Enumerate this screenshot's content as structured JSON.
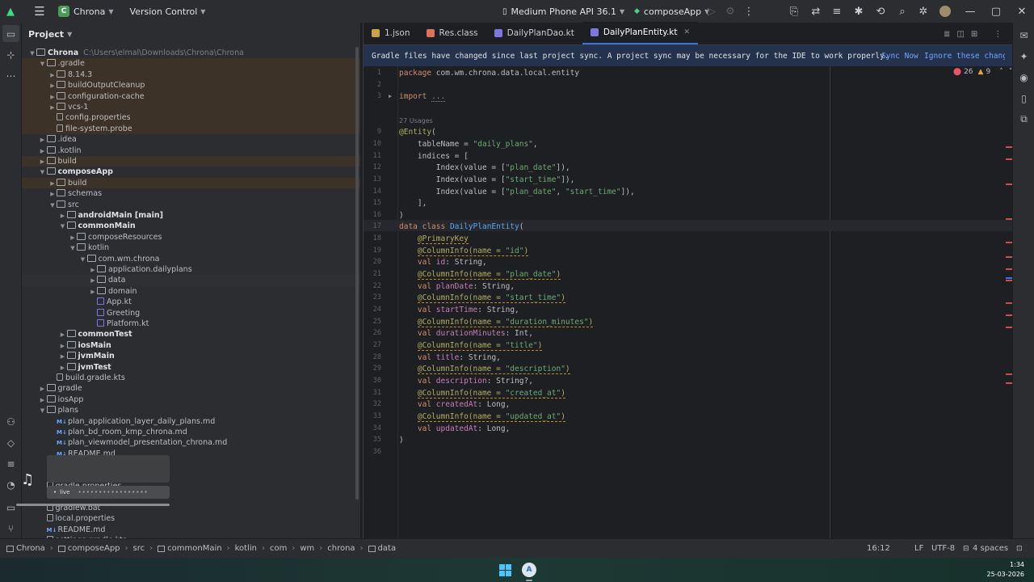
{
  "titlebar": {
    "project": "Chrona",
    "project_initial": "C",
    "version_control": "Version Control",
    "device": "Medium Phone API 36.1",
    "run_config": "composeApp"
  },
  "project_panel": {
    "title": "Project"
  },
  "tree": [
    {
      "label": "Chrona",
      "extra": "C:\\Users\\elmal\\Downloads\\Chrona\\Chrona",
      "indent": 0,
      "arrow": "down",
      "icon": "folder",
      "bold": true,
      "bg": ""
    },
    {
      "label": ".gradle",
      "indent": 1,
      "arrow": "down",
      "icon": "folder",
      "bg": "orange"
    },
    {
      "label": "8.14.3",
      "indent": 2,
      "arrow": "right",
      "icon": "folder",
      "bg": "orange"
    },
    {
      "label": "buildOutputCleanup",
      "indent": 2,
      "arrow": "right",
      "icon": "folder",
      "bg": "orange"
    },
    {
      "label": "configuration-cache",
      "indent": 2,
      "arrow": "right",
      "icon": "folder",
      "bg": "orange"
    },
    {
      "label": "vcs-1",
      "indent": 2,
      "arrow": "right",
      "icon": "folder",
      "bg": "orange"
    },
    {
      "label": "config.properties",
      "indent": 2,
      "arrow": "",
      "icon": "file",
      "bg": "orange"
    },
    {
      "label": "file-system.probe",
      "indent": 2,
      "arrow": "",
      "icon": "file",
      "bg": "orange"
    },
    {
      "label": ".idea",
      "indent": 1,
      "arrow": "right",
      "icon": "folder",
      "bg": ""
    },
    {
      "label": ".kotlin",
      "indent": 1,
      "arrow": "right",
      "icon": "folder",
      "bg": ""
    },
    {
      "label": "build",
      "indent": 1,
      "arrow": "right",
      "icon": "folder",
      "bg": "orange"
    },
    {
      "label": "composeApp",
      "indent": 1,
      "arrow": "down",
      "icon": "folder",
      "bold": true,
      "bg": ""
    },
    {
      "label": "build",
      "indent": 2,
      "arrow": "right",
      "icon": "folder",
      "bg": "orange"
    },
    {
      "label": "schemas",
      "indent": 2,
      "arrow": "right",
      "icon": "folder",
      "bg": ""
    },
    {
      "label": "src",
      "indent": 2,
      "arrow": "down",
      "icon": "folder",
      "bg": ""
    },
    {
      "label": "androidMain [main]",
      "indent": 3,
      "arrow": "right",
      "icon": "folder",
      "bold": true,
      "bg": ""
    },
    {
      "label": "commonMain",
      "indent": 3,
      "arrow": "down",
      "icon": "folder",
      "bold": true,
      "bg": ""
    },
    {
      "label": "composeResources",
      "indent": 4,
      "arrow": "right",
      "icon": "folder",
      "bg": ""
    },
    {
      "label": "kotlin",
      "indent": 4,
      "arrow": "down",
      "icon": "folder",
      "bg": ""
    },
    {
      "label": "com.wm.chrona",
      "indent": 5,
      "arrow": "down",
      "icon": "folder",
      "bg": ""
    },
    {
      "label": "application.dailyplans",
      "indent": 6,
      "arrow": "right",
      "icon": "folder",
      "bg": ""
    },
    {
      "label": "data",
      "indent": 6,
      "arrow": "right",
      "icon": "folder",
      "bg": "hl"
    },
    {
      "label": "domain",
      "indent": 6,
      "arrow": "right",
      "icon": "folder",
      "bg": ""
    },
    {
      "label": "App.kt",
      "indent": 6,
      "arrow": "",
      "icon": "kt",
      "bg": ""
    },
    {
      "label": "Greeting",
      "indent": 6,
      "arrow": "",
      "icon": "kt",
      "bg": ""
    },
    {
      "label": "Platform.kt",
      "indent": 6,
      "arrow": "",
      "icon": "kt",
      "bg": ""
    },
    {
      "label": "commonTest",
      "indent": 3,
      "arrow": "right",
      "icon": "folder",
      "bold": true,
      "bg": ""
    },
    {
      "label": "iosMain",
      "indent": 3,
      "arrow": "right",
      "icon": "folder",
      "bold": true,
      "bg": ""
    },
    {
      "label": "jvmMain",
      "indent": 3,
      "arrow": "right",
      "icon": "folder",
      "bold": true,
      "bg": ""
    },
    {
      "label": "jvmTest",
      "indent": 3,
      "arrow": "right",
      "icon": "folder",
      "bold": true,
      "bg": ""
    },
    {
      "label": "build.gradle.kts",
      "indent": 2,
      "arrow": "",
      "icon": "file",
      "bg": ""
    },
    {
      "label": "gradle",
      "indent": 1,
      "arrow": "right",
      "icon": "folder",
      "bg": ""
    },
    {
      "label": "iosApp",
      "indent": 1,
      "arrow": "right",
      "icon": "folder",
      "bg": ""
    },
    {
      "label": "plans",
      "indent": 1,
      "arrow": "down",
      "icon": "folder",
      "bg": ""
    },
    {
      "label": "plan_application_layer_daily_plans.md",
      "indent": 2,
      "arrow": "",
      "icon": "md",
      "bg": ""
    },
    {
      "label": "plan_bd_room_kmp_chrona.md",
      "indent": 2,
      "arrow": "",
      "icon": "md",
      "bg": ""
    },
    {
      "label": "plan_viewmodel_presentation_chrona.md",
      "indent": 2,
      "arrow": "",
      "icon": "md",
      "bg": ""
    },
    {
      "label": "README.md",
      "indent": 2,
      "arrow": "",
      "icon": "md",
      "bg": ""
    },
    {
      "label": "",
      "indent": 1,
      "arrow": "",
      "icon": "",
      "bg": ""
    },
    {
      "label": "",
      "indent": 1,
      "arrow": "",
      "icon": "",
      "bg": ""
    },
    {
      "label": "gradle.properties",
      "indent": 1,
      "arrow": "",
      "icon": "file",
      "bg": ""
    },
    {
      "label": "",
      "indent": 1,
      "arrow": "",
      "icon": "",
      "bg": ""
    },
    {
      "label": "gradlew.bat",
      "indent": 1,
      "arrow": "",
      "icon": "file",
      "bg": ""
    },
    {
      "label": "local.properties",
      "indent": 1,
      "arrow": "",
      "icon": "file",
      "bg": ""
    },
    {
      "label": "README.md",
      "indent": 1,
      "arrow": "",
      "icon": "md",
      "bg": ""
    },
    {
      "label": "settings.gradle.kts",
      "indent": 1,
      "arrow": "",
      "icon": "file",
      "bg": ""
    }
  ],
  "tabs": [
    {
      "label": "1.json",
      "color": "#c9a24a",
      "active": false
    },
    {
      "label": "Res.class",
      "color": "#d9735b",
      "active": false
    },
    {
      "label": "DailyPlanDao.kt",
      "color": "#7f77dd",
      "active": false
    },
    {
      "label": "DailyPlanEntity.kt",
      "color": "#7f77dd",
      "active": true
    }
  ],
  "banner": {
    "message": "Gradle files have changed since last project sync. A project sync may be necessary for the IDE to work properly.",
    "sync_now": "Sync Now",
    "ignore": "Ignore these changes"
  },
  "inspections": {
    "errors": "26",
    "warnings": "9"
  },
  "code_lines": [
    {
      "n": "1",
      "html": "<span class='kw'>package</span> com.wm.chrona.data.local.entity"
    },
    {
      "n": "2",
      "html": ""
    },
    {
      "n": "3",
      "html": "<span class='kw'>import</span> <span style='color:#8c8f94;border-bottom:1px dotted #8c8f94'>...</span>"
    },
    {
      "n": "",
      "html": ""
    },
    {
      "n": "",
      "html": "<span style='color:#7b7e85;font-size:8px;font-family:\"DejaVu Sans\",sans-serif'>27 Usages</span>"
    },
    {
      "n": "9",
      "html": "<span class='ann'>@Entity</span>("
    },
    {
      "n": "10",
      "html": "    <span class='prop' style='color:#bcbec4'>tableName</span> = <span class='str'>\"daily_plans\"</span>,"
    },
    {
      "n": "11",
      "html": "    indices = ["
    },
    {
      "n": "12",
      "html": "        <span class='fn' style='color:#bcbec4'>Index</span>(value = [<span class='str'>\"plan_date\"</span>]),"
    },
    {
      "n": "13",
      "html": "        Index(value = [<span class='str'>\"start_time\"</span>]),"
    },
    {
      "n": "14",
      "html": "        Index(value = [<span class='str'>\"plan_date\"</span>, <span class='str'>\"start_time\"</span>]),"
    },
    {
      "n": "15",
      "html": "    ],"
    },
    {
      "n": "16",
      "html": ")"
    },
    {
      "n": "17",
      "html": "<span class='kw'>data class</span> <span class='fn'>DailyPlanEntity</span>("
    },
    {
      "n": "18",
      "html": "    <span class='ann und'>@PrimaryKey</span>"
    },
    {
      "n": "19",
      "html": "    <span class='ann und'>@ColumnInfo(name = <span class='str'>\"id\"</span>)</span>"
    },
    {
      "n": "20",
      "html": "    <span class='kw'>val</span> <span class='prop'>id</span>: String,"
    },
    {
      "n": "21",
      "html": "    <span class='ann und'>@ColumnInfo(name = <span class='str'>\"plan_date\"</span>)</span>"
    },
    {
      "n": "22",
      "html": "    <span class='kw'>val</span> <span class='prop'>planDate</span>: String,"
    },
    {
      "n": "23",
      "html": "    <span class='ann und'>@ColumnInfo(name = <span class='str'>\"start_time\"</span>)</span>"
    },
    {
      "n": "24",
      "html": "    <span class='kw'>val</span> <span class='prop'>startTime</span>: String,"
    },
    {
      "n": "25",
      "html": "    <span class='ann und'>@ColumnInfo(name = <span class='str'>\"duration_minutes\"</span>)</span>"
    },
    {
      "n": "26",
      "html": "    <span class='kw'>val</span> <span class='prop'>durationMinutes</span>: Int,"
    },
    {
      "n": "27",
      "html": "    <span class='ann und'>@ColumnInfo(name = <span class='str'>\"title\"</span>)</span>"
    },
    {
      "n": "28",
      "html": "    <span class='kw'>val</span> <span class='prop'>title</span>: String,"
    },
    {
      "n": "29",
      "html": "    <span class='ann und'>@ColumnInfo(name = <span class='str'>\"description\"</span>)</span>"
    },
    {
      "n": "30",
      "html": "    <span class='kw'>val</span> <span class='prop'>description</span>: String?,"
    },
    {
      "n": "31",
      "html": "    <span class='ann und'>@ColumnInfo(name = <span class='str'>\"created_at\"</span>)</span>"
    },
    {
      "n": "32",
      "html": "    <span class='kw'>val</span> <span class='prop'>createdAt</span>: Long,"
    },
    {
      "n": "33",
      "html": "    <span class='ann und'>@ColumnInfo(name = <span class='str'>\"updated_at\"</span>)</span>"
    },
    {
      "n": "34",
      "html": "    <span class='kw'>val</span> <span class='prop'>updatedAt</span>: Long,"
    },
    {
      "n": "35",
      "html": ")"
    },
    {
      "n": "36",
      "html": ""
    }
  ],
  "statusbar": {
    "breadcrumbs": [
      "Chrona",
      "composeApp",
      "src",
      "commonMain",
      "kotlin",
      "com",
      "wm",
      "chrona",
      "data"
    ],
    "position": "16:12",
    "line_sep": "LF",
    "encoding": "UTF-8",
    "indent": "4 spaces"
  },
  "media": {
    "live_label": "live"
  },
  "taskbar": {
    "time": "1:34",
    "date": "25-03-2026"
  }
}
